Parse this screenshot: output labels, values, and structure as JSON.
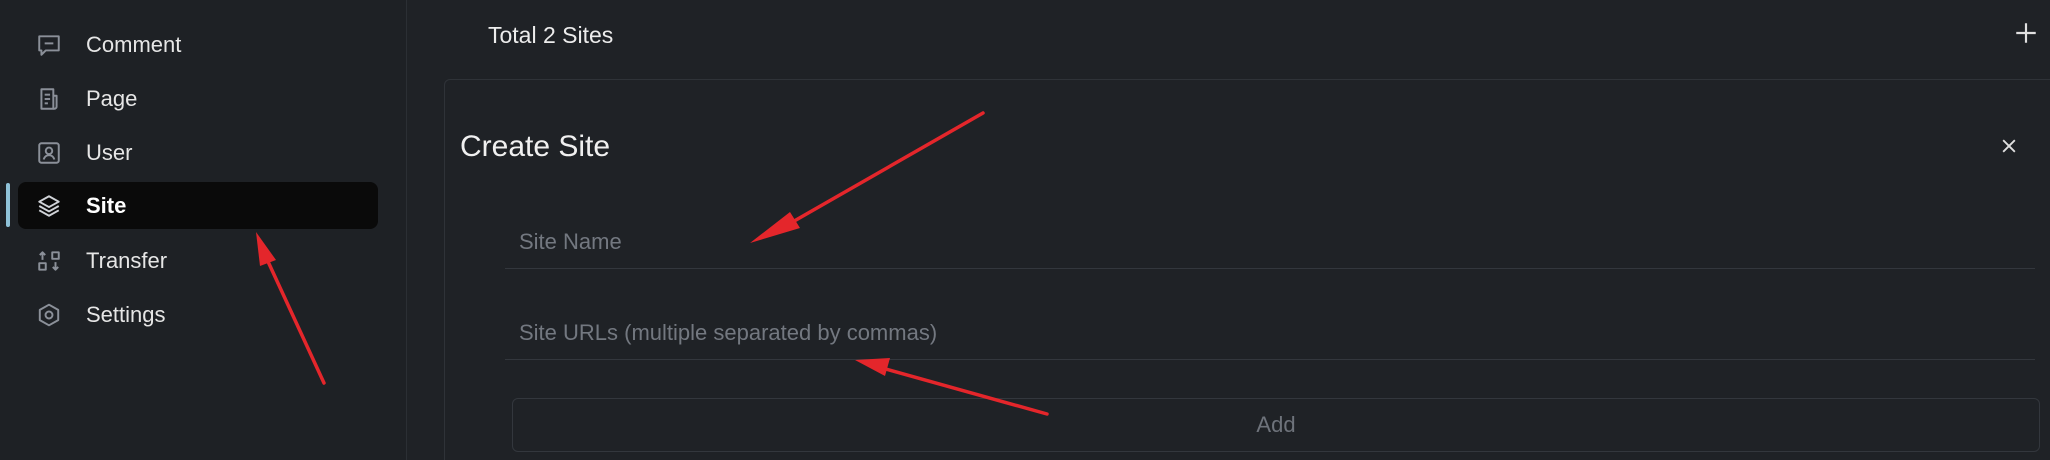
{
  "sidebar": {
    "items": [
      {
        "label": "Comment",
        "icon": "comment-icon",
        "active": false
      },
      {
        "label": "Page",
        "icon": "page-icon",
        "active": false
      },
      {
        "label": "User",
        "icon": "user-icon",
        "active": false
      },
      {
        "label": "Site",
        "icon": "layers-icon",
        "active": true
      },
      {
        "label": "Transfer",
        "icon": "transfer-icon",
        "active": false
      },
      {
        "label": "Settings",
        "icon": "settings-icon",
        "active": false
      }
    ]
  },
  "header": {
    "total_label": "Total 2 Sites",
    "add_icon": "plus-icon"
  },
  "create_site": {
    "title": "Create Site",
    "close_icon": "close-icon",
    "site_name_placeholder": "Site Name",
    "site_urls_placeholder": "Site URLs (multiple separated by commas)",
    "add_label": "Add"
  },
  "colors": {
    "background": "#1f2226",
    "active_item_bg": "#0a0a0a",
    "active_indicator": "#8fc2d8",
    "annotation_arrow": "#e4262b"
  }
}
